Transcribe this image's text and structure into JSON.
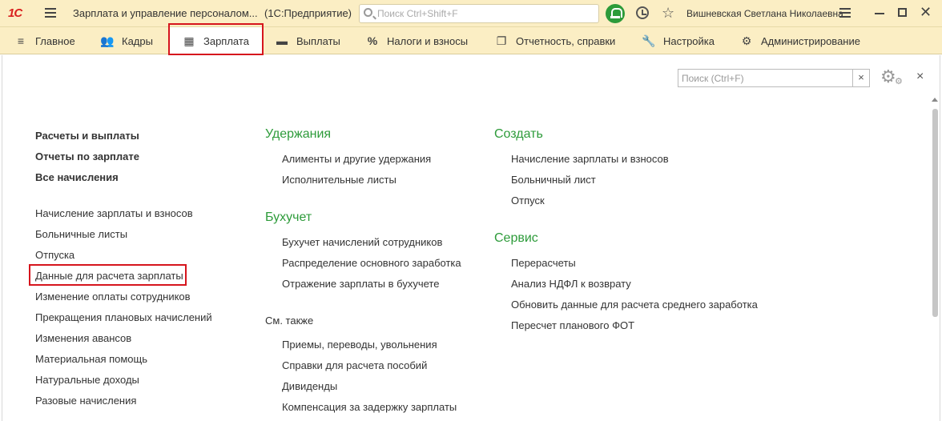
{
  "titlebar": {
    "logo": "1С",
    "title": "Зарплата и управление персоналом...",
    "platform": "(1С:Предприятие)",
    "search_placeholder": "Поиск Ctrl+Shift+F",
    "user": "Вишневская Светлана Николаевна"
  },
  "sections": [
    {
      "label": "Главное",
      "icon": "menu-lines-icon"
    },
    {
      "label": "Кадры",
      "icon": "people-icon"
    },
    {
      "label": "Зарплата",
      "icon": "calculator-icon"
    },
    {
      "label": "Выплаты",
      "icon": "wallet-icon"
    },
    {
      "label": "Налоги и взносы",
      "icon": "percent-icon"
    },
    {
      "label": "Отчетность, справки",
      "icon": "documents-icon"
    },
    {
      "label": "Настройка",
      "icon": "wrench-icon"
    },
    {
      "label": "Администрирование",
      "icon": "gear-icon"
    }
  ],
  "panel": {
    "search_placeholder": "Поиск (Ctrl+F)",
    "clear": "×",
    "close": "×"
  },
  "col1": {
    "bold_links": [
      "Расчеты и выплаты",
      "Отчеты по зарплате",
      "Все начисления"
    ],
    "links": [
      "Начисление зарплаты и взносов",
      "Больничные листы",
      "Отпуска",
      "Данные для расчета зарплаты",
      "Изменение оплаты сотрудников",
      "Прекращения плановых начислений",
      "Изменения авансов",
      "Материальная помощь",
      "Натуральные доходы",
      "Разовые начисления"
    ]
  },
  "col2": {
    "group1": {
      "title": "Удержания",
      "links": [
        "Алименты и другие удержания",
        "Исполнительные листы"
      ]
    },
    "group2": {
      "title": "Бухучет",
      "links": [
        "Бухучет начислений сотрудников",
        "Распределение основного заработка",
        "Отражение зарплаты в бухучете"
      ]
    },
    "group3": {
      "title": "См. также",
      "links": [
        "Приемы, переводы, увольнения",
        "Справки для расчета пособий",
        "Дивиденды",
        "Компенсация за задержку зарплаты"
      ]
    }
  },
  "col3": {
    "group1": {
      "title": "Создать",
      "links": [
        "Начисление зарплаты и взносов",
        "Больничный лист",
        "Отпуск"
      ]
    },
    "group2": {
      "title": "Сервис",
      "links": [
        "Перерасчеты",
        "Анализ НДФЛ к возврату",
        "Обновить данные для расчета среднего заработка",
        "Пересчет планового ФОТ"
      ]
    }
  },
  "colors": {
    "accent_green": "#2d9b3a",
    "highlight_red": "#d6151d",
    "bar_yellow": "#fbeec4"
  }
}
